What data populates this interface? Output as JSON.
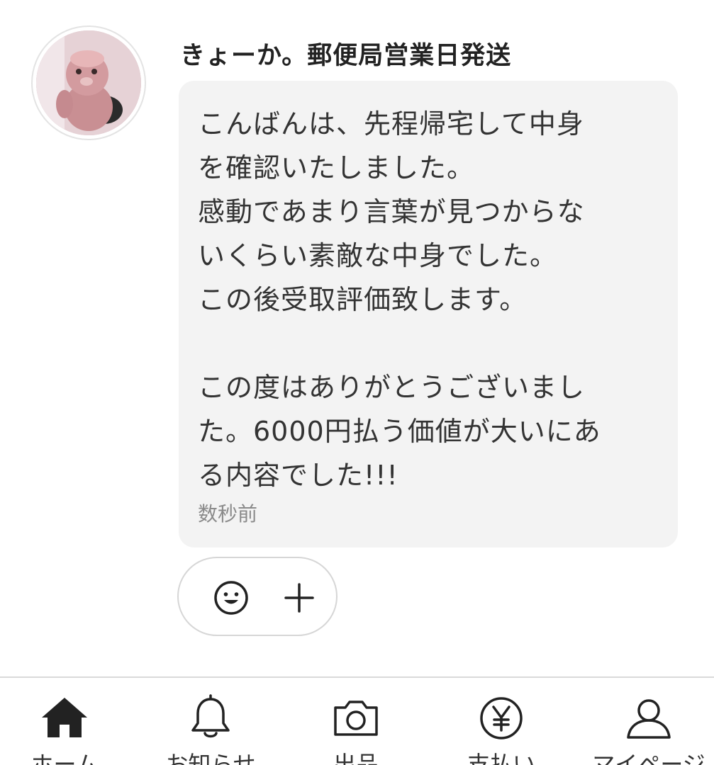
{
  "sender": {
    "name": "きょーか。郵便局営業日発送"
  },
  "message": {
    "text": "こんばんは、先程帰宅して中身\nを確認いたしました。\n感動であまり言葉が見つからな\nいくらい素敵な中身でした。\nこの後受取評価致します。\n\nこの度はありがとうございまし\nた。6000円払う価値が大いにあ\nる内容でした!!!",
    "timestamp": "数秒前"
  },
  "reactions": {
    "emoji_icon": "smile-face-icon",
    "add_icon": "plus-icon"
  },
  "nav": {
    "items": [
      {
        "label": "ホーム",
        "icon": "home-icon"
      },
      {
        "label": "お知らせ",
        "icon": "bell-icon"
      },
      {
        "label": "出品",
        "icon": "camera-icon"
      },
      {
        "label": "支払い",
        "icon": "yen-circle-icon"
      },
      {
        "label": "マイページ",
        "icon": "person-icon"
      }
    ]
  },
  "colors": {
    "bubble_bg": "#f3f3f3",
    "text": "#333333",
    "muted": "#8a8a8a",
    "border": "#d9d9d9"
  }
}
